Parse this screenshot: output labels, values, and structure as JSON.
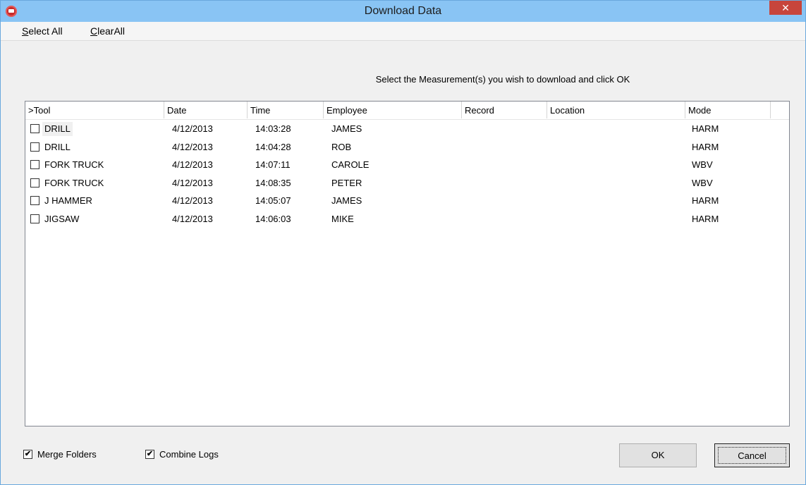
{
  "window": {
    "title": "Download Data",
    "close_glyph": "✕"
  },
  "menu": {
    "select_all": "Select All",
    "clear_all": "ClearAll"
  },
  "instruction": "Select the Measurement(s) you wish to download and click OK",
  "table": {
    "columns": [
      ">Tool",
      "Date",
      "Time",
      "Employee",
      "Record",
      "Location",
      "Mode"
    ],
    "rows": [
      {
        "checked": false,
        "tool": "DRILL",
        "date": "4/12/2013",
        "time": "14:03:28",
        "employee": "JAMES",
        "record": "",
        "location": "",
        "mode": "HARM"
      },
      {
        "checked": false,
        "tool": "DRILL",
        "date": "4/12/2013",
        "time": "14:04:28",
        "employee": "ROB",
        "record": "",
        "location": "",
        "mode": "HARM"
      },
      {
        "checked": false,
        "tool": "FORK TRUCK",
        "date": "4/12/2013",
        "time": "14:07:11",
        "employee": "CAROLE",
        "record": "",
        "location": "",
        "mode": "WBV"
      },
      {
        "checked": false,
        "tool": "FORK TRUCK",
        "date": "4/12/2013",
        "time": "14:08:35",
        "employee": "PETER",
        "record": "",
        "location": "",
        "mode": "WBV"
      },
      {
        "checked": false,
        "tool": "J HAMMER",
        "date": "4/12/2013",
        "time": "14:05:07",
        "employee": "JAMES",
        "record": "",
        "location": "",
        "mode": "HARM"
      },
      {
        "checked": false,
        "tool": "JIGSAW",
        "date": "4/12/2013",
        "time": "14:06:03",
        "employee": "MIKE",
        "record": "",
        "location": "",
        "mode": "HARM"
      }
    ]
  },
  "options": {
    "merge_folders": {
      "label": "Merge Folders",
      "checked": true
    },
    "combine_logs": {
      "label": "Combine Logs",
      "checked": true
    }
  },
  "buttons": {
    "ok": "OK",
    "cancel": "Cancel"
  },
  "check_glyph": "✔"
}
